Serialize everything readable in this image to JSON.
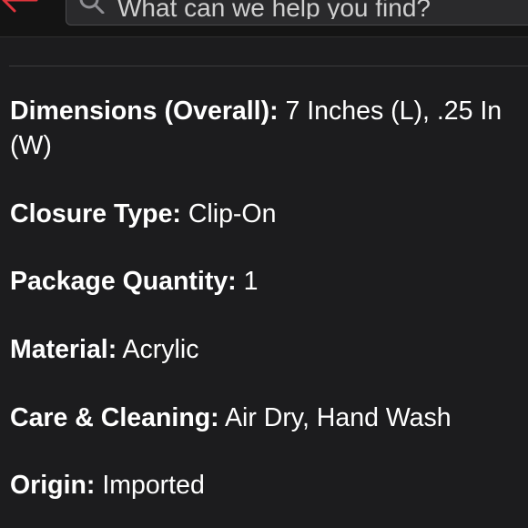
{
  "header": {
    "search": {
      "placeholder": "What can we help you find?"
    },
    "back_icon_color": "#e0343c"
  },
  "specs": [
    {
      "label": "Dimensions (Overall):",
      "value": " 7 Inches (L), .25 In",
      "value_wrap": "(W)"
    },
    {
      "label": "Closure Type:",
      "value": " Clip-On"
    },
    {
      "label": "Package Quantity:",
      "value": " 1"
    },
    {
      "label": "Material:",
      "value": " Acrylic"
    },
    {
      "label": "Care & Cleaning:",
      "value": " Air Dry, Hand Wash"
    },
    {
      "label": "Origin:",
      "value": " Imported"
    }
  ]
}
